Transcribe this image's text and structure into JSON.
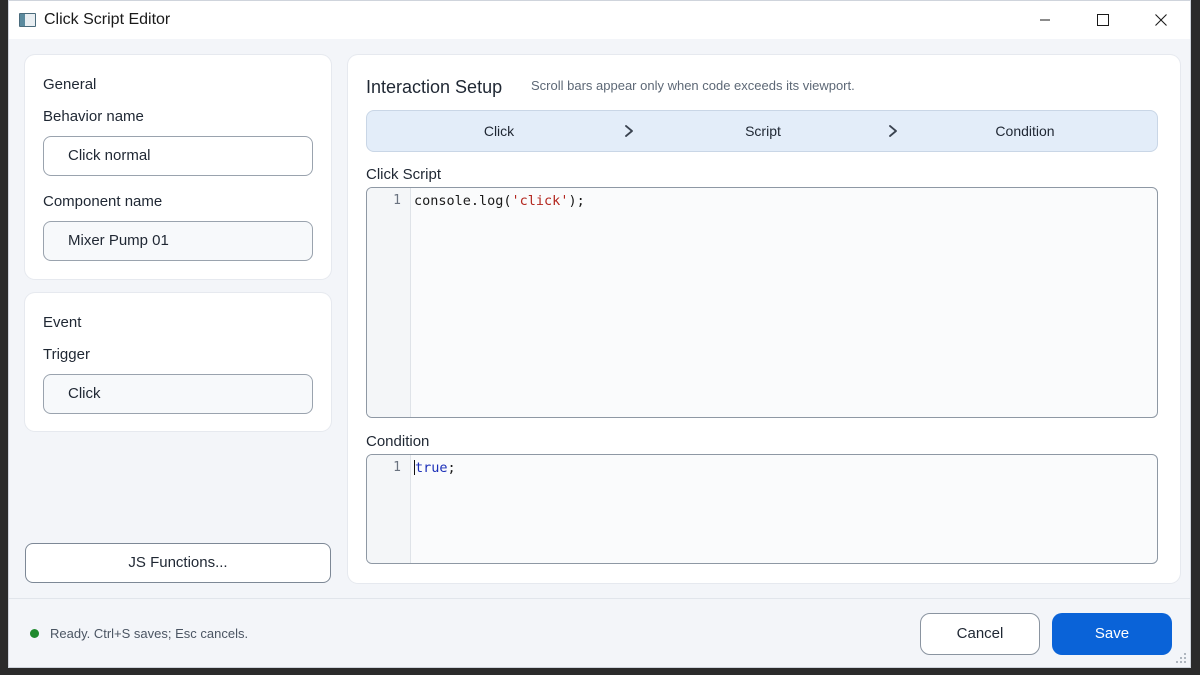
{
  "window": {
    "title": "Click Script Editor"
  },
  "general": {
    "section_title": "General",
    "behavior_label": "Behavior name",
    "behavior_value": "Click normal",
    "component_label": "Component name",
    "component_value": "Mixer Pump 01"
  },
  "event": {
    "section_title": "Event",
    "trigger_label": "Trigger",
    "trigger_value": "Click"
  },
  "js_functions_label": "JS Functions...",
  "setup": {
    "title": "Interaction Setup",
    "hint": "Scroll bars appear only when code exceeds its viewport.",
    "steps": [
      "Click",
      "Script",
      "Condition"
    ]
  },
  "click_script": {
    "label": "Click Script",
    "lines": [
      {
        "num": "1",
        "code_prefix": "console.log(",
        "code_string": "'click'",
        "code_suffix": ");"
      }
    ]
  },
  "condition": {
    "label": "Condition",
    "lines": [
      {
        "num": "1",
        "code_keyword": "true",
        "code_suffix": ";"
      }
    ]
  },
  "status": {
    "text": "Ready. Ctrl+S saves; Esc cancels.",
    "color": "#1f8a2e"
  },
  "actions": {
    "cancel_label": "Cancel",
    "save_label": "Save",
    "save_color": "#0a63d8"
  },
  "icons": {
    "app": "app-window-icon",
    "minimize": "minimize-icon",
    "maximize": "maximize-icon",
    "close": "close-icon",
    "step_separator": "chevron-right-icon",
    "resize": "resize-grip-icon"
  }
}
